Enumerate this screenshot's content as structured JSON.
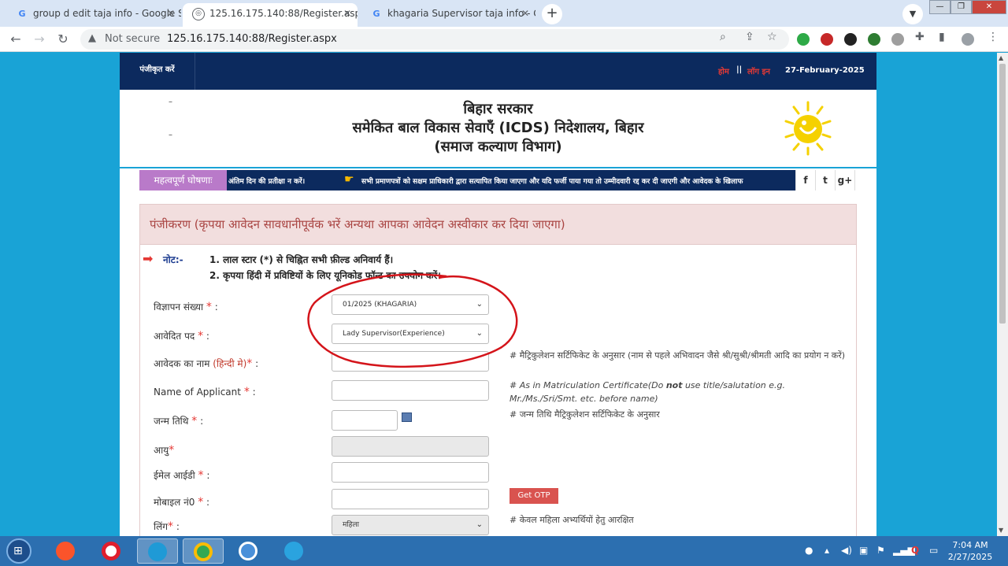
{
  "browser": {
    "tabs": [
      {
        "title": "group d edit taja info - Google S",
        "active": false,
        "icon": "google-icon"
      },
      {
        "title": "125.16.175.140:88/Register.aspx",
        "active": true,
        "icon": "globe-icon"
      },
      {
        "title": "khagaria Supervisor taja info - G",
        "active": false,
        "icon": "google-icon"
      }
    ],
    "not_secure": "Not secure",
    "url": "125.16.175.140:88/Register.aspx"
  },
  "site": {
    "nav_register": "पंजीकृत करें",
    "nav_home": "होम",
    "nav_sep": "||",
    "nav_login": "लॉग इन",
    "date": "27-February-2025",
    "header_line1": "बिहार सरकार",
    "header_line2": "समेकित बाल विकास सेवाएँ (ICDS) निदेशालय, बिहार",
    "header_line3": "(समाज कल्याण विभाग)",
    "dash": "–"
  },
  "ticker": {
    "label": "महत्वपूर्ण घोषणाः",
    "text1": "अंतिम दिन की प्रतीक्षा न करें।",
    "text2": "सभी प्रमाणपत्रों को सक्षम प्राधिकारी द्वारा सत्यापित किया जाएगा और यदि फर्जी पाया गया तो उम्मीदवारी रद्द कर दी जाएगी और आवेदक के खिलाफ"
  },
  "form": {
    "heading": "पंजीकरण (कृपया आवेदन सावधानीपूर्वक भरें अन्यथा आपका आवेदन अस्वीकार कर दिया जाएगा)",
    "note_label": "नोट:-",
    "note1": "1. लाल स्टार (*) से चिह्नित सभी फ़ील्ड अनिवार्य हैं।",
    "note2": "2. कृपया हिंदी में प्रविष्टियों के लिए यूनिकोड फॉन्ट का उपयोग करें।",
    "req": "*",
    "colon": ":",
    "fields": {
      "advt_label": "विज्ञापन संख्या",
      "advt_value": "01/2025 (KHAGARIA)",
      "post_label": "आवेदित पद",
      "post_value": "Lady Supervisor(Experience)",
      "name_hi_label": "आवेदक का नाम",
      "name_hi_tag": "(हिन्दी मे)",
      "name_hi_hint": "# मैट्रिकुलेशन सर्टिफिकेट के अनुसार (नाम से पहले अभिवादन जैसे श्री/सुश्री/श्रीमती आदि का प्रयोग न करें)",
      "name_en_label": "Name of Applicant",
      "name_en_hint_a": "# As in Matriculation Certificate(",
      "name_en_hint_b": "Do ",
      "name_en_hint_c": "not",
      "name_en_hint_d": " use title/salutation e.g. Mr./Ms./Sri/Smt. etc. before name)",
      "dob_label": "जन्म तिथि",
      "dob_hint": "# जन्म तिथि मैट्रिकुलेशन सर्टिफिकेट के अनुसार",
      "age_label": "आयु",
      "email_label": "ईमेल आईडी",
      "mobile_label": "मोबाइल नं0",
      "otp_button": "Get OTP",
      "gender_label": "लिंग",
      "gender_value": "महिला",
      "gender_hint": "# केवल महिला अभ्यर्थियों हेतु आरक्षित"
    }
  },
  "taskbar": {
    "time": "7:04 AM",
    "date": "2/27/2025"
  }
}
